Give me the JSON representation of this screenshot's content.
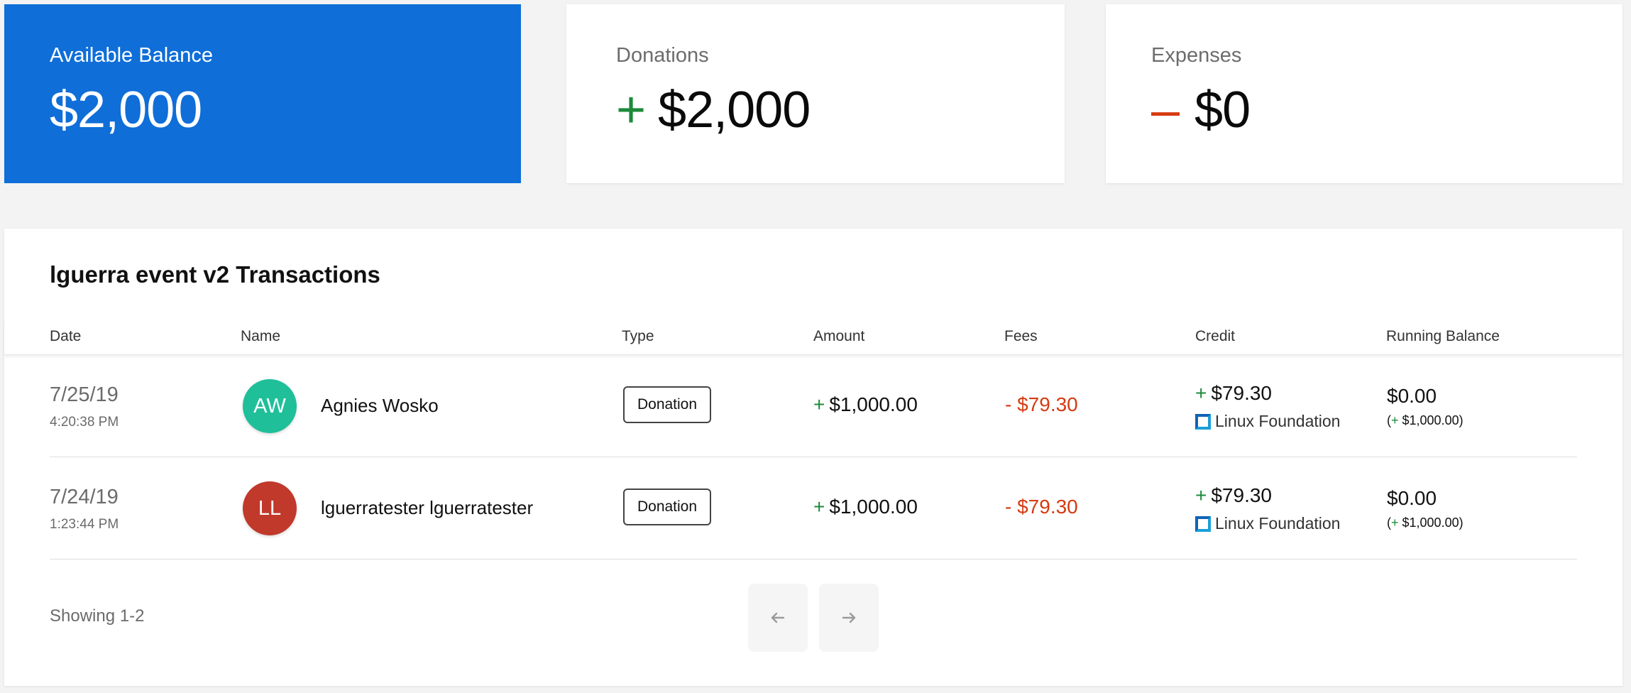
{
  "summary": {
    "balance": {
      "label": "Available Balance",
      "value": "$2,000"
    },
    "donations": {
      "label": "Donations",
      "sign": "+",
      "value": "$2,000"
    },
    "expenses": {
      "label": "Expenses",
      "sign": "–",
      "value": "$0"
    }
  },
  "transactions": {
    "title": "lguerra event v2 Transactions",
    "columns": {
      "date": "Date",
      "name": "Name",
      "type": "Type",
      "amount": "Amount",
      "fees": "Fees",
      "credit": "Credit",
      "running_balance": "Running Balance"
    },
    "rows": [
      {
        "date": "7/25/19",
        "time": "4:20:38 PM",
        "initials": "AW",
        "avatar_color": "#1fbf9a",
        "name": "Agnies Wosko",
        "type": "Donation",
        "amount_sign": "+",
        "amount": "$1,000.00",
        "fees": "- $79.30",
        "credit_sign": "+",
        "credit": "$79.30",
        "credit_org": "Linux Foundation",
        "running_balance": "$0.00",
        "running_open": "(",
        "running_sign": "+",
        "running_delta": " $1,000.00)"
      },
      {
        "date": "7/24/19",
        "time": "1:23:44 PM",
        "initials": "LL",
        "avatar_color": "#c0392b",
        "name": "lguerratester lguerratester",
        "type": "Donation",
        "amount_sign": "+",
        "amount": "$1,000.00",
        "fees": "- $79.30",
        "credit_sign": "+",
        "credit": "$79.30",
        "credit_org": "Linux Foundation",
        "running_balance": "$0.00",
        "running_open": "(",
        "running_sign": "+",
        "running_delta": " $1,000.00)"
      }
    ],
    "footer": {
      "showing": "Showing 1-2",
      "prev_icon": "arrow-left-icon",
      "next_icon": "arrow-right-icon"
    }
  },
  "colors": {
    "accent": "#0f6ed8",
    "positive": "#1d8a3a",
    "negative": "#d63b12"
  }
}
